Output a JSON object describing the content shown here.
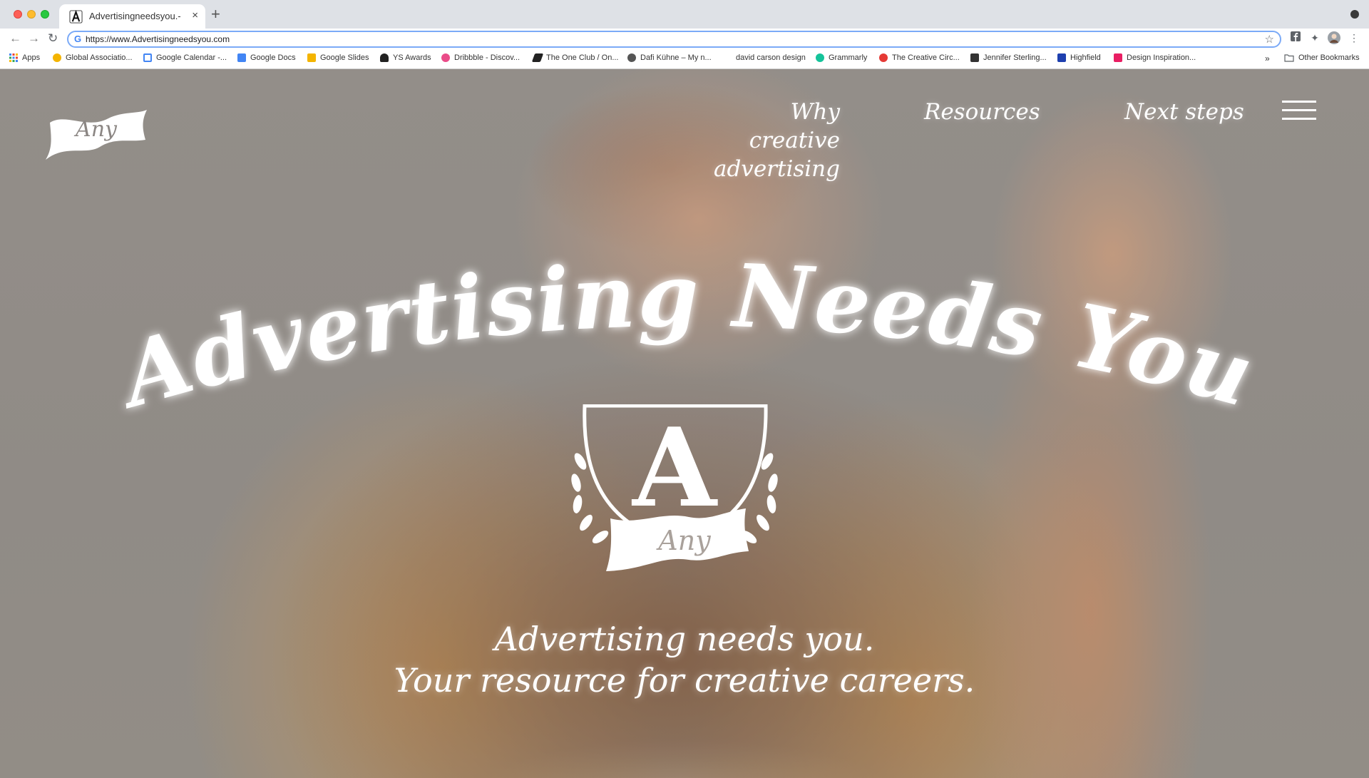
{
  "browser": {
    "tab_title": "Advertisingneedsyou.-",
    "tab_close": "×",
    "new_tab": "+",
    "url": "https://www.Advertisingneedsyou.com",
    "bookmarks": [
      {
        "label": "Apps",
        "color": "#e44"
      },
      {
        "label": "Global Associatio...",
        "color": "#f4b400"
      },
      {
        "label": "Google Calendar -...",
        "color": "#4285f4"
      },
      {
        "label": "Google Docs",
        "color": "#4285f4"
      },
      {
        "label": "Google Slides",
        "color": "#f4b400"
      },
      {
        "label": "YS Awards",
        "color": "#222222"
      },
      {
        "label": "Dribbble - Discov...",
        "color": "#ea4c89"
      },
      {
        "label": "The One Club / On...",
        "color": "#222222"
      },
      {
        "label": "Dafi Kühne – My n...",
        "color": "#555555"
      },
      {
        "label": "david carson design",
        "color": "#ffffff"
      },
      {
        "label": "Grammarly",
        "color": "#15c39a"
      },
      {
        "label": "The Creative Circ...",
        "color": "#e53935"
      },
      {
        "label": "Jennifer Sterling...",
        "color": "#333333"
      },
      {
        "label": "Highfield",
        "color": "#1e40af"
      },
      {
        "label": "Design Inspiration...",
        "color": "#e91e63"
      }
    ],
    "overflow": "»",
    "other_bookmarks": "Other Bookmarks"
  },
  "site": {
    "logo_text": "Any",
    "nav": {
      "why_line1": "Why creative",
      "why_line2": "advertising",
      "resources": "Resources",
      "next_steps": "Next steps"
    },
    "headline": "Advertising Needs You",
    "crest_letter": "A",
    "crest_ribbon": "Any",
    "tagline_line1": "Advertising needs you.",
    "tagline_line2": "Your resource for creative careers."
  }
}
